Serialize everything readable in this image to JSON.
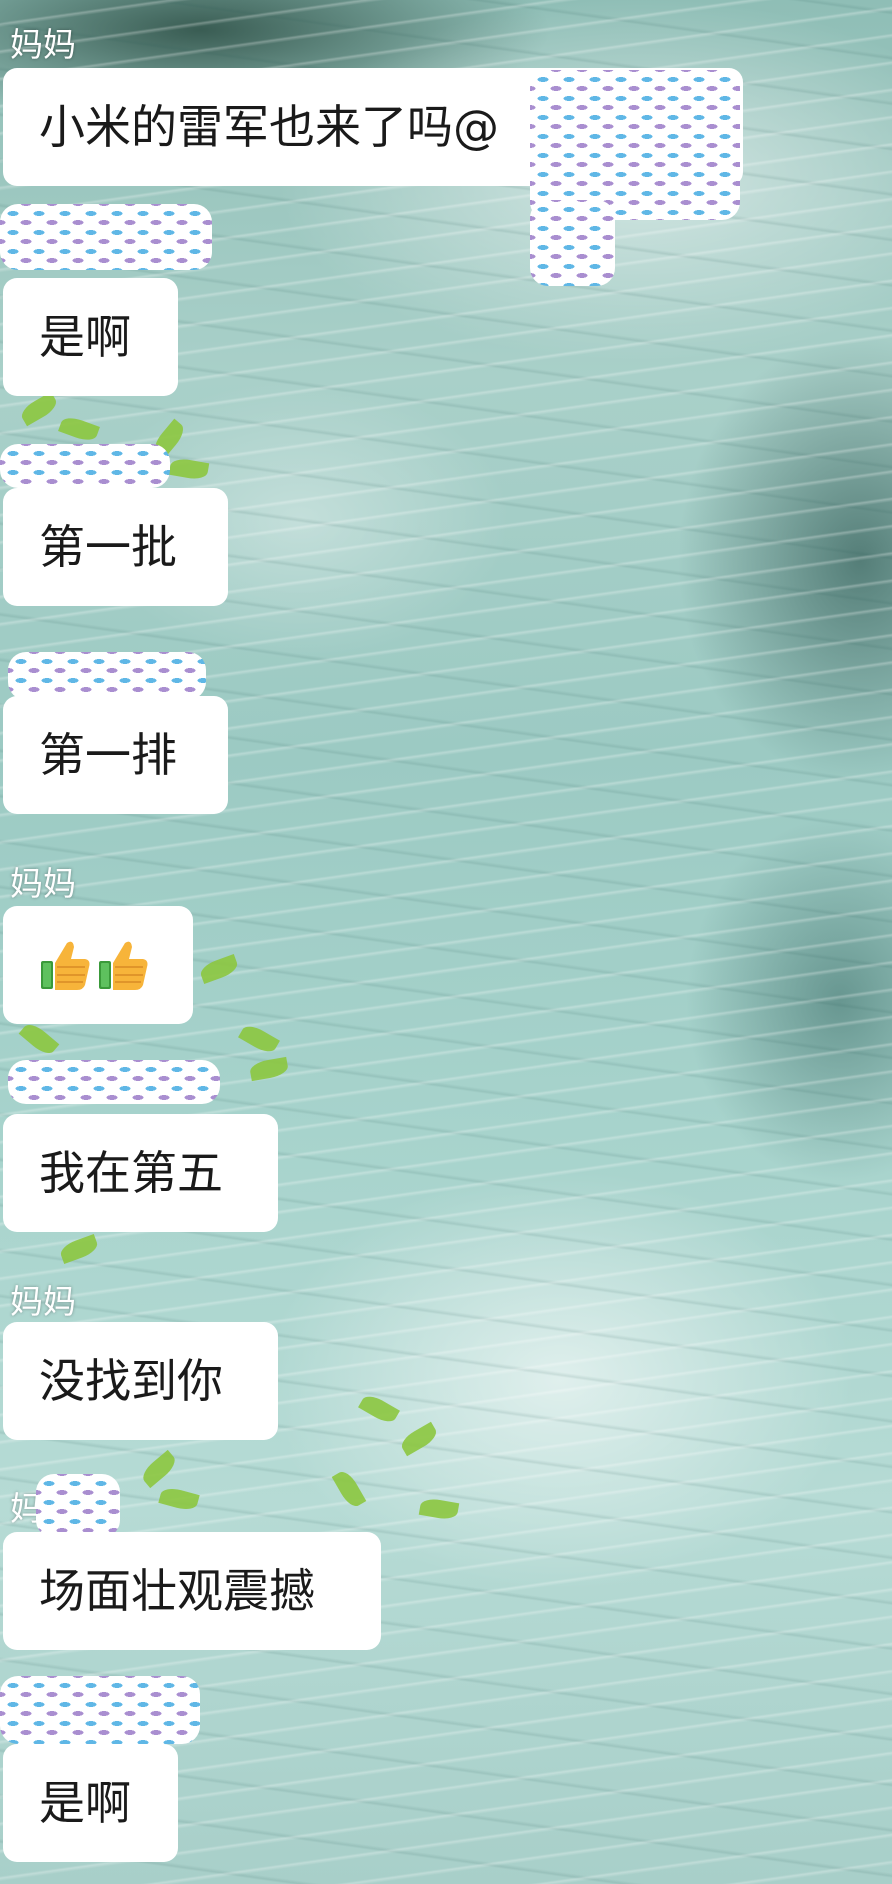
{
  "chat": {
    "messages": [
      {
        "sender": "妈妈",
        "text": "小米的雷军也来了吗@"
      },
      {
        "sender": "",
        "text": "是啊"
      },
      {
        "sender": "",
        "text": "第一批"
      },
      {
        "sender": "",
        "text": "第一排"
      },
      {
        "sender": "妈妈",
        "text": "👍👍"
      },
      {
        "sender": "",
        "text": "我在第五"
      },
      {
        "sender": "妈妈",
        "text": "没找到你"
      },
      {
        "sender": "妈",
        "text": "场面壮观震撼"
      },
      {
        "sender": "",
        "text": "是啊"
      }
    ]
  },
  "colors": {
    "bubble": "#ffffff",
    "text": "#1a1a1a",
    "sender_name": "#ffffff",
    "mask_fish_blue": "#5fb7e6",
    "mask_fish_purple": "#a98ed0"
  },
  "icons": [
    "thumbs-up-icon",
    "thumbs-up-icon"
  ]
}
